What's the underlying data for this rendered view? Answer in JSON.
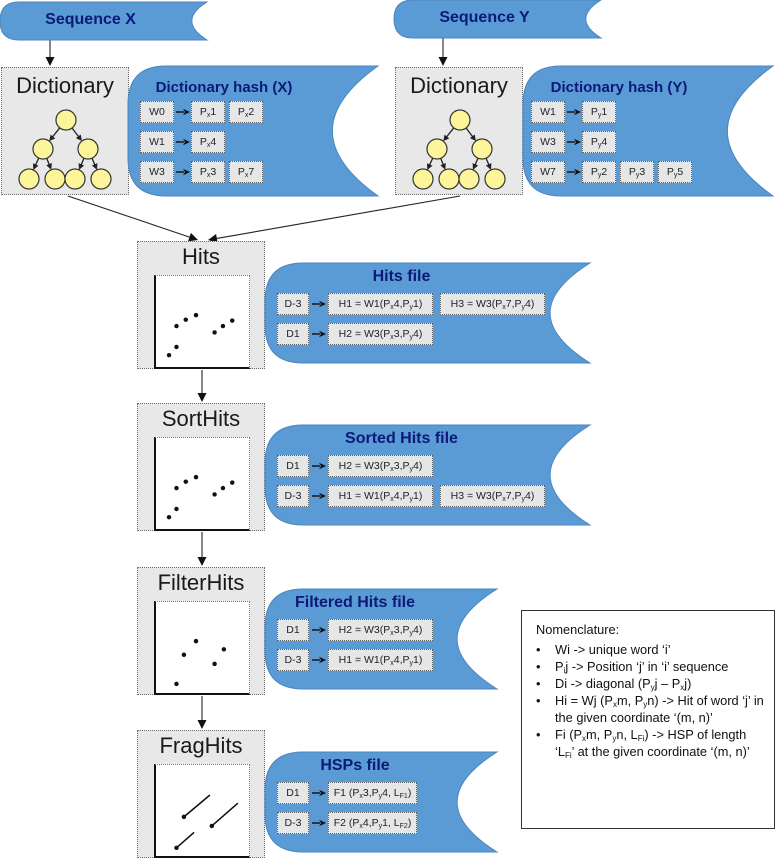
{
  "colors": {
    "banner_fill": "#5b9bd5",
    "banner_title": "#0b1a78",
    "process_box": "#e8e8e8",
    "chip_fill": "#e6e6e6",
    "tree_node": "#fdf59a"
  },
  "sources": [
    {
      "id": "seq-x",
      "title": "Sequence X"
    },
    {
      "id": "seq-y",
      "title": "Sequence Y"
    }
  ],
  "dictionaries": [
    {
      "id": "x",
      "process": "Dictionary",
      "file_title": "Dictionary hash (X)",
      "rows": [
        {
          "key": "W0",
          "values": [
            {
              "p": "P",
              "s": "x",
              "n": "1"
            },
            {
              "p": "P",
              "s": "x",
              "n": "2"
            }
          ]
        },
        {
          "key": "W1",
          "values": [
            {
              "p": "P",
              "s": "x",
              "n": "4"
            }
          ]
        },
        {
          "key": "W3",
          "values": [
            {
              "p": "P",
              "s": "x",
              "n": "3"
            },
            {
              "p": "P",
              "s": "x",
              "n": "7"
            }
          ]
        }
      ]
    },
    {
      "id": "y",
      "process": "Dictionary",
      "file_title": "Dictionary hash (Y)",
      "rows": [
        {
          "key": "W1",
          "values": [
            {
              "p": "P",
              "s": "y",
              "n": "1"
            }
          ]
        },
        {
          "key": "W3",
          "values": [
            {
              "p": "P",
              "s": "y",
              "n": "4"
            }
          ]
        },
        {
          "key": "W7",
          "values": [
            {
              "p": "P",
              "s": "y",
              "n": "2"
            },
            {
              "p": "P",
              "s": "y",
              "n": "3"
            },
            {
              "p": "P",
              "s": "y",
              "n": "5"
            }
          ]
        }
      ]
    }
  ],
  "stages": [
    {
      "id": "hits",
      "process": "Hits",
      "file_title": "Hits file",
      "plot": "dots",
      "rows": [
        {
          "key": "D-3",
          "entries": [
            "H1 = W1(P|x|4,P|y|1)",
            "H3 = W3(P|x|7,P|y|4)"
          ]
        },
        {
          "key": "D1",
          "entries": [
            "H2 = W3(P|x|3,P|y|4)"
          ]
        }
      ]
    },
    {
      "id": "sorthits",
      "process": "SortHits",
      "file_title": "Sorted Hits file",
      "plot": "dots",
      "rows": [
        {
          "key": "D1",
          "entries": [
            "H2 = W3(P|x|3,P|y|4)"
          ]
        },
        {
          "key": "D-3",
          "entries": [
            "H1 = W1(P|x|4,P|y|1)",
            "H3 = W3(P|x|7,P|y|4)"
          ]
        }
      ]
    },
    {
      "id": "filterhits",
      "process": "FilterHits",
      "file_title": "Filtered Hits file",
      "plot": "filtered",
      "rows": [
        {
          "key": "D1",
          "entries": [
            "H2 = W3(P|x|3,P|y|4)"
          ]
        },
        {
          "key": "D-3",
          "entries": [
            "H1 = W1(P|x|4,P|y|1)"
          ]
        }
      ]
    },
    {
      "id": "fraghits",
      "process": "FragHits",
      "file_title": "HSPs file",
      "plot": "segments",
      "rows": [
        {
          "key": "D1",
          "entries": [
            "F1 (P|x|3,P|y|4, L|F1|)"
          ]
        },
        {
          "key": "D-3",
          "entries": [
            "F2 (P|x|4,P|y|1, L|F2|)"
          ]
        }
      ]
    }
  ],
  "nomenclature": {
    "title": "Nomenclature:",
    "items": [
      "Wi -> unique word ‘i’",
      "P|i|j -> Position ‘j’ in ‘i’ sequence",
      "Di -> diagonal (P|y|j – P|x|j)",
      "Hi = Wj (P|x|m, P|y|n) -> Hit of word ‘j’ in the given coordinate ‘(m, n)’",
      "Fi (P|x|m, P|y|n, L|Fi|) -> HSP of length ‘L|Fi|’ at the given coordinate ‘(m, n)’"
    ]
  }
}
